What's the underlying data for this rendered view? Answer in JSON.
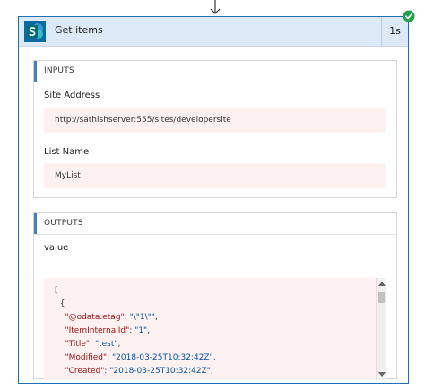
{
  "action": {
    "title": "Get items",
    "duration": "1s",
    "status": "succeeded",
    "brand_color": "#0b6a9e",
    "success_color": "#22a04a"
  },
  "inputs": {
    "header": "INPUTS",
    "site_address": {
      "label": "Site Address",
      "value": "http://sathishserver:555/sites/developersite"
    },
    "list_name": {
      "label": "List Name",
      "value": "MyList"
    }
  },
  "outputs": {
    "header": "OUTPUTS",
    "value_label": "value",
    "lines": [
      {
        "indent": "",
        "key": "",
        "val": "",
        "tail": "["
      },
      {
        "indent": "  ",
        "key": "",
        "val": "",
        "tail": "{"
      },
      {
        "indent": "    ",
        "key": "\"@odata.etag\"",
        "val": "\"\\\"1\\\"\"",
        "tail": ","
      },
      {
        "indent": "    ",
        "key": "\"ItemInternalId\"",
        "val": "\"1\"",
        "tail": ","
      },
      {
        "indent": "    ",
        "key": "\"Title\"",
        "val": "\"test\"",
        "tail": ","
      },
      {
        "indent": "    ",
        "key": "\"Modified\"",
        "val": "\"2018-03-25T10:32:42Z\"",
        "tail": ","
      },
      {
        "indent": "    ",
        "key": "\"Created\"",
        "val": "\"2018-03-25T10:32:42Z\"",
        "tail": ","
      }
    ]
  }
}
